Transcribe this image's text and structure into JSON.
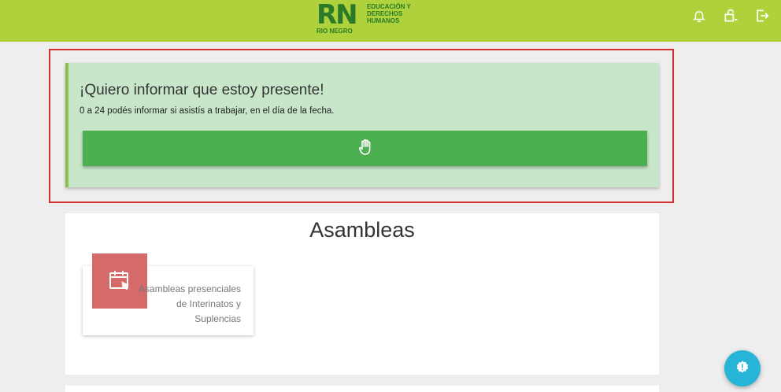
{
  "header": {
    "logo_rn": "RN",
    "logo_sub": "RIO NEGRO",
    "logo_text": "EDUCACIÓN Y DERECHOS HUMANOS",
    "icons": [
      "bell-icon",
      "user-lock-icon",
      "logout-icon"
    ]
  },
  "present": {
    "title": "¡Quiero informar que estoy presente!",
    "subtitle": "0 a 24 podés informar si asistís a trabajar, en el día de la fecha.",
    "button_icon": "hand-icon"
  },
  "asambleas": {
    "title": "Asambleas",
    "card_text": "Asambleas presenciales de Interinatos y Suplencias",
    "card_icon": "calendar-cursor-icon"
  },
  "fab": {
    "icon": "alert-icon"
  },
  "colors": {
    "topbar": "#afd23c",
    "card_bg": "#c8e6c9",
    "button": "#4caf50",
    "highlight": "#d32f2f",
    "icon_box": "#d66a6a",
    "fab": "#26b5d6"
  }
}
